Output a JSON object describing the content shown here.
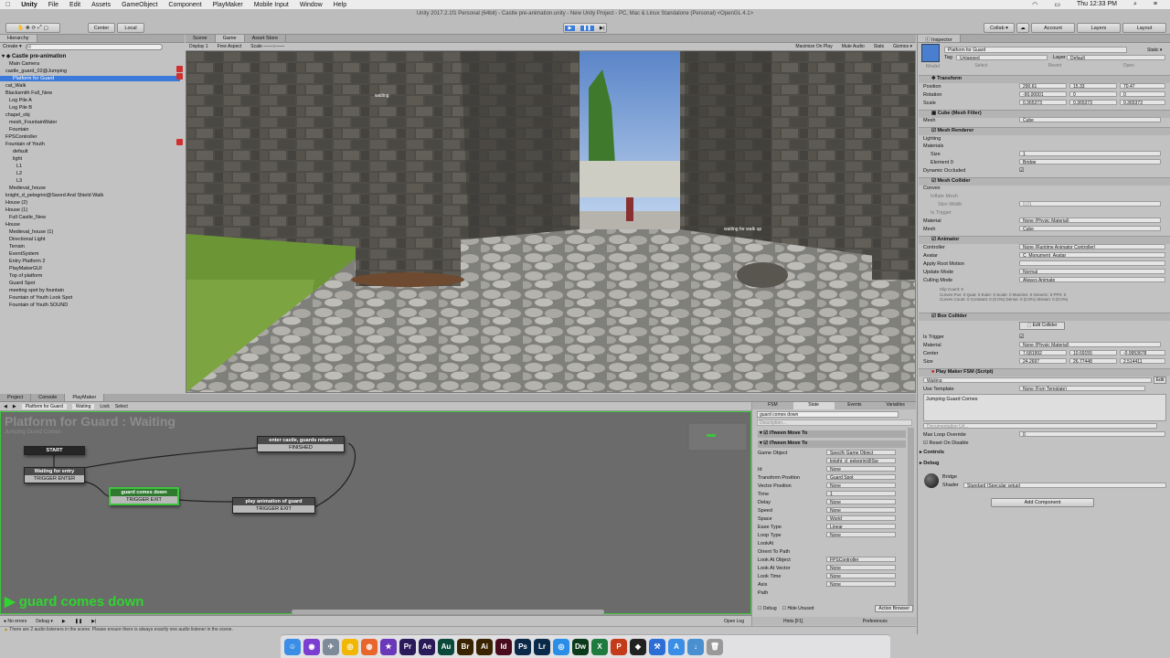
{
  "menubar": {
    "app": "Unity",
    "items": [
      "File",
      "Edit",
      "Assets",
      "GameObject",
      "Component",
      "PlayMaker",
      "Mobile Input",
      "Window",
      "Help"
    ],
    "clock": "Thu 12:33 PM"
  },
  "window_title": "Unity 2017.2.1f1 Personal (64bit) - Castle pre-animation.unity - New Unity Project - PC, Mac & Linux Standalone (Personal) <OpenGL 4.1>",
  "toolbar": {
    "pivot": "Center",
    "space": "Local",
    "collab": "Collab ▾",
    "account": "Account",
    "layers": "Layers",
    "layout": "Layout"
  },
  "hierarchy": {
    "tab": "Hierarchy",
    "create": "Create ▾",
    "search_placeholder": "All",
    "scene": "Castle pre-animation",
    "items": [
      {
        "label": "Main Camera",
        "indent": 1
      },
      {
        "label": "castle_guard_02@Jumping",
        "indent": 0
      },
      {
        "label": "Platform for Guard",
        "indent": 1
      },
      {
        "label": "cat_Walk",
        "indent": 0
      },
      {
        "label": "Blacksmith Full_New",
        "indent": 0
      },
      {
        "label": "Log Pile A",
        "indent": 1
      },
      {
        "label": "Log Pile B",
        "indent": 1
      },
      {
        "label": "chapel_obj",
        "indent": 0
      },
      {
        "label": "mesh_FountainWater",
        "indent": 1
      },
      {
        "label": "Fountain",
        "indent": 1
      },
      {
        "label": "FPSController",
        "indent": 0
      },
      {
        "label": "Fountain of Youth",
        "indent": 0
      },
      {
        "label": "default",
        "indent": 2
      },
      {
        "label": "light",
        "indent": 2
      },
      {
        "label": "L1",
        "indent": 3
      },
      {
        "label": "L2",
        "indent": 3
      },
      {
        "label": "L3",
        "indent": 3
      },
      {
        "label": "Medieval_house",
        "indent": 1
      },
      {
        "label": "knight_d_pelegrini@Sword And Shield Walk",
        "indent": 0
      },
      {
        "label": "House (2)",
        "indent": 0
      },
      {
        "label": "House (1)",
        "indent": 0
      },
      {
        "label": "Full Castle_New",
        "indent": 1
      },
      {
        "label": "House",
        "indent": 0
      },
      {
        "label": "Medieval_house (1)",
        "indent": 1
      },
      {
        "label": "Directional Light",
        "indent": 1
      },
      {
        "label": "Terrain",
        "indent": 1
      },
      {
        "label": "EventSystem",
        "indent": 1
      },
      {
        "label": "Entry Platform 2",
        "indent": 1
      },
      {
        "label": "PlayMakerGUI",
        "indent": 1
      },
      {
        "label": "Top of platform",
        "indent": 1
      },
      {
        "label": "Guard Spot",
        "indent": 1
      },
      {
        "label": "meeting spot by fountain",
        "indent": 1
      },
      {
        "label": "Fountain of Youth Look Spot",
        "indent": 1
      },
      {
        "label": "Fountain of Youth SOUND",
        "indent": 1
      }
    ]
  },
  "view_tabs": [
    "Scene",
    "Game",
    "Asset Store"
  ],
  "game_bar": {
    "display": "Display 1",
    "aspect": "Free Aspect",
    "scale": "Scale",
    "options": [
      "Maximize On Play",
      "Mute Audio",
      "Stats",
      "Gizmos ▾"
    ]
  },
  "scene_labels": [
    "waiting",
    "waiting for walk up"
  ],
  "bottom_tabs": [
    "Project",
    "Console",
    "PlayMaker"
  ],
  "fsm_bar": [
    "Platform for Guard",
    "Waiting",
    "Lock",
    "Select"
  ],
  "fsm": {
    "title": "Platform for Guard : Waiting",
    "subtitle": "Jumping Guard Comes",
    "start": "START",
    "states": [
      {
        "name": "Waiting for entry",
        "event": "TRIGGER ENTER"
      },
      {
        "name": "guard comes down",
        "event": "TRIGGER EXIT"
      },
      {
        "name": "enter castle, guards return",
        "event": "FINISHED"
      },
      {
        "name": "play animation of guard",
        "event": "TRIGGER EXIT"
      }
    ],
    "active_label": "guard comes down"
  },
  "fsm_inspector": {
    "tabs": [
      "FSM",
      "State",
      "Events",
      "Variables"
    ],
    "state_name": "guard comes down",
    "description_placeholder": "Description...",
    "actions": [
      "iTween Move To",
      "iTween Move To"
    ],
    "rows": [
      {
        "label": "Game Object",
        "value": "Specify Game Object"
      },
      {
        "label": "",
        "value": "knight_d_pelegrini@Sw"
      },
      {
        "label": "Id",
        "value": "None"
      },
      {
        "label": "Transform Position",
        "value": "Guard Spot"
      },
      {
        "label": "Vector Position",
        "value": "None"
      },
      {
        "label": "Time",
        "value": "1"
      },
      {
        "label": "Delay",
        "value": "None"
      },
      {
        "label": "Speed",
        "value": "None"
      },
      {
        "label": "Space",
        "value": "World"
      },
      {
        "label": "Ease Type",
        "value": "Linear"
      },
      {
        "label": "Loop Type",
        "value": "None"
      },
      {
        "label": "LookAt",
        "value": ""
      },
      {
        "label": "Orient To Path",
        "value": ""
      },
      {
        "label": "Look At Object",
        "value": "FPSController"
      },
      {
        "label": "Look At Vector",
        "value": "None"
      },
      {
        "label": "Look Time",
        "value": "None"
      },
      {
        "label": "Axis",
        "value": "None"
      },
      {
        "label": "Path",
        "value": ""
      }
    ],
    "debug": "Debug",
    "hide_unused": "Hide Unused",
    "action_browser": "Action Browser",
    "hints": "Hints [F1]",
    "preferences": "Preferences"
  },
  "fsm_footer": {
    "no_errors": "No errors",
    "debug": "Debug ▾",
    "open_log": "Open Log"
  },
  "status_message": "There are 2 audio listeners in the scene. Please ensure there is always exactly one audio listener in the scene.",
  "inspector": {
    "tab": "Inspector",
    "object_name": "Platform for Guard",
    "static": "Static",
    "tag_label": "Tag",
    "tag": "Untagged",
    "layer_label": "Layer",
    "layer": "Default",
    "model": "Model",
    "model_buttons": [
      "Select",
      "Revert",
      "Open"
    ],
    "transform": {
      "title": "Transform",
      "position": {
        "label": "Position",
        "x": "290.61",
        "y": "15.33",
        "z": "70.47"
      },
      "rotation": {
        "label": "Rotation",
        "x": "-90.00001",
        "y": "0",
        "z": "0"
      },
      "scale": {
        "label": "Scale",
        "x": "0.365373",
        "y": "0.365373",
        "z": "0.365373"
      }
    },
    "mesh_filter": {
      "title": "Cube (Mesh Filter)",
      "mesh_label": "Mesh",
      "mesh": "Cube"
    },
    "mesh_renderer": {
      "title": "Mesh Renderer",
      "lighting": "Lighting",
      "materials": "Materials",
      "size_label": "Size",
      "size": "1",
      "element_label": "Element 0",
      "element": "Bridge",
      "dynamic": "Dynamic Occluded"
    },
    "mesh_collider": {
      "title": "Mesh Collider",
      "rows": [
        "Convex",
        "Inflate Mesh",
        "Skin Width",
        "Is Trigger",
        "Material",
        "Mesh"
      ],
      "skin_width": "0.01",
      "material": "None (Physic Material)",
      "mesh": "Cube"
    },
    "animator": {
      "title": "Animator",
      "rows": [
        {
          "label": "Controller",
          "value": "None (Runtime Animator Controller)"
        },
        {
          "label": "Avatar",
          "value": "C_Monument_Avatar"
        },
        {
          "label": "Apply Root Motion",
          "value": ""
        },
        {
          "label": "Update Mode",
          "value": "Normal"
        },
        {
          "label": "Culling Mode",
          "value": "Always Animate"
        }
      ],
      "info": [
        "Clip Count: 0",
        "Curves Pos: 0 Quat: 0 Euler: 0 Scale: 0 Muscles: 0 Generic: 0 PPtr: 0",
        "Curves Count: 0 Constant: 0 (0.0%) Dense: 0 (0.0%) Stream: 0 (0.0%)"
      ]
    },
    "box_collider": {
      "title": "Box Collider",
      "edit": "Edit Collider",
      "is_trigger": "Is Trigger",
      "material_label": "Material",
      "material": "None (Physic Material)",
      "center": {
        "label": "Center",
        "x": "7.681992",
        "y": "10.69155",
        "z": "-0.9953678"
      },
      "size": {
        "label": "Size",
        "x": "24.2697",
        "y": "26.77448",
        "z": "2.514411"
      }
    },
    "playmaker": {
      "title": "Play Maker FSM (Script)",
      "fsm_name": "Waiting",
      "use_template_label": "Use Template",
      "use_template": "None (Fsm Template)",
      "description": "Jumping Guard Comes",
      "doc_placeholder": "Documentation Url...",
      "max_loop_label": "Max Loop Override",
      "max_loop": "0",
      "reset_on_disable": "Reset On Disable",
      "controls": "Controls",
      "debug": "Debug",
      "edit": "Edit"
    },
    "material": {
      "name": "Bridge",
      "shader_label": "Shader",
      "shader": "Standard (Specular setup)"
    },
    "add_component": "Add Component"
  },
  "dock": {
    "icons": [
      "finder-icon",
      "siri-icon",
      "launchpad-icon",
      "chrome-icon",
      "firefox-icon",
      "imovie-icon",
      "premiere-icon",
      "aftereffects-icon",
      "audition-icon",
      "bridge-icon",
      "illustrator-icon",
      "indesign-icon",
      "photoshop-icon",
      "lightroom-icon",
      "safari-icon",
      "dreamweaver-icon",
      "excel-icon",
      "powerpoint-icon",
      "unity-icon",
      "xcode-icon",
      "appstore-icon",
      "downloads-icon",
      "trash-icon"
    ]
  }
}
